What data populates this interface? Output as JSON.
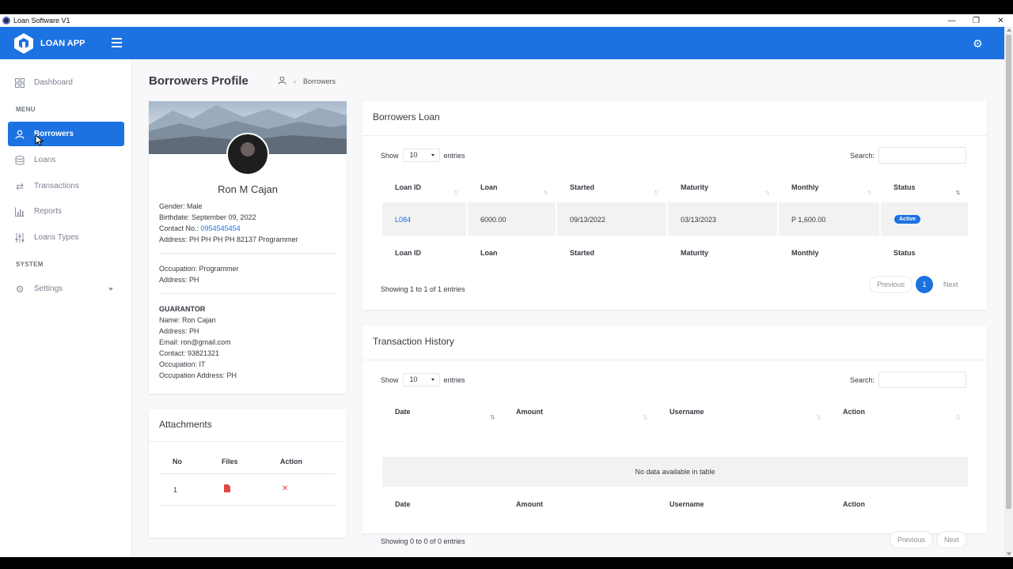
{
  "window": {
    "title": "Loan Software V1",
    "minimize": "—",
    "maximize": "❐",
    "close": "✕"
  },
  "header": {
    "brand": "LOAN APP",
    "accent_color": "#1c72e0"
  },
  "sidebar": {
    "dashboard": "Dashboard",
    "menu_section": "MENU",
    "borrowers": "Borrowers",
    "loans": "Loans",
    "transactions": "Transactions",
    "reports": "Reports",
    "loan_types": "Loans Types",
    "system_section": "SYSTEM",
    "settings": "Settings"
  },
  "page": {
    "title": "Borrowers Profile",
    "breadcrumb": "Borrowers"
  },
  "profile": {
    "name": "Ron M Cajan",
    "gender": "Gender: Male",
    "birthdate": "Birthdate: September 09, 2022",
    "contact_label": "Contact No.:",
    "contact_value": "0954545454",
    "address": "Address: PH PH PH PH 82137 Programmer",
    "occupation": "Occupation: Programmer",
    "address2": "Address: PH",
    "guarantor_title": "GUARANTOR",
    "g_name": "Name: Ron Cajan",
    "g_address": "Address: PH",
    "g_email": "Email: ron@gmail.com",
    "g_contact": "Contact: 93821321",
    "g_occupation": "Occupation: IT",
    "g_occ_address": "Occupation Address: PH"
  },
  "attachments": {
    "title": "Attachments",
    "columns": {
      "no": "No",
      "files": "Files",
      "action": "Action"
    },
    "rows": [
      {
        "no": "1"
      }
    ]
  },
  "loan_table": {
    "title": "Borrowers Loan",
    "show": "Show",
    "entries_value": "10",
    "entries": "entries",
    "search": "Search:",
    "columns": {
      "loan_id": "Loan ID",
      "loan": "Loan",
      "started": "Started",
      "maturity": "Maturity",
      "monthly": "Monthly",
      "status": "Status"
    },
    "rows": [
      {
        "loan_id": "L084",
        "loan": "6000.00",
        "started": "09/13/2022",
        "maturity": "03/13/2023",
        "monthly": "P 1,600.00",
        "status": "Active"
      }
    ],
    "info": "Showing 1 to 1 of 1 entries",
    "previous": "Previous",
    "page": "1",
    "next": "Next"
  },
  "trans_table": {
    "title": "Transaction History",
    "show": "Show",
    "entries_value": "10",
    "entries": "entries",
    "search": "Search:",
    "columns": {
      "date": "Date",
      "amount": "Amount",
      "username": "Username",
      "action": "Action"
    },
    "empty": "No data available in table",
    "info": "Showing 0 to 0 of 0 entries",
    "previous": "Previous",
    "next": "Next"
  }
}
